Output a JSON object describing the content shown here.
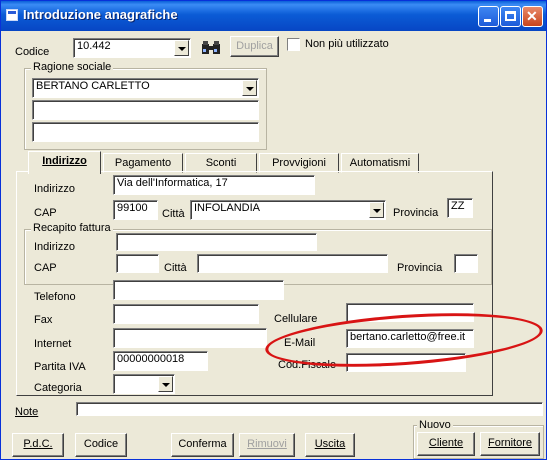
{
  "window": {
    "title": "Introduzione anagrafiche"
  },
  "header": {
    "codice_label": "Codice",
    "codice_value": "10.442",
    "duplica_label": "Duplica",
    "non_utilizzato_label": "Non più utilizzato",
    "non_utilizzato_checked": false
  },
  "ragione_sociale": {
    "title": "Ragione sociale",
    "line1": "BERTANO CARLETTO",
    "line2": "",
    "line3": ""
  },
  "tabs": [
    {
      "label": "Indirizzo",
      "active": true
    },
    {
      "label": "Pagamento",
      "active": false
    },
    {
      "label": "Sconti",
      "active": false
    },
    {
      "label": "Provvigioni",
      "active": false
    },
    {
      "label": "Automatismi",
      "active": false
    }
  ],
  "indirizzo": {
    "indirizzo_label": "Indirizzo",
    "indirizzo_value": "Via dell'Informatica, 17",
    "cap_label": "CAP",
    "cap_value": "99100",
    "citta_label": "Città",
    "citta_value": "INFOLANDIA",
    "provincia_label": "Provincia",
    "provincia_value": "ZZ"
  },
  "recapito": {
    "title": "Recapito fattura",
    "indirizzo_label": "Indirizzo",
    "indirizzo_value": "",
    "cap_label": "CAP",
    "cap_value": "",
    "citta_label": "Città",
    "citta_value": "",
    "provincia_label": "Provincia",
    "provincia_value": ""
  },
  "contatti": {
    "telefono_label": "Telefono",
    "telefono_value": "",
    "fax_label": "Fax",
    "fax_value": "",
    "cellulare_label": "Cellulare",
    "cellulare_value": "",
    "internet_label": "Internet",
    "internet_value": "",
    "email_label": "E-Mail",
    "email_value": "bertano.carletto@free.it",
    "partita_iva_label": "Partita IVA",
    "partita_iva_value": "00000000018",
    "cod_fiscale_label": "Cod.Fiscale",
    "cod_fiscale_value": "",
    "categoria_label": "Categoria",
    "categoria_value": ""
  },
  "note": {
    "label": "Note",
    "value": ""
  },
  "buttons": {
    "pdc": "P.d.C.",
    "codice": "Codice",
    "conferma": "Conferma",
    "rimuovi": "Rimuovi",
    "uscita": "Uscita",
    "nuovo_title": "Nuovo",
    "cliente": "Cliente",
    "fornitore": "Fornitore"
  },
  "colors": {
    "title_bar": "#0b5cd6",
    "highlight_ellipse": "#d81414",
    "dialog_bg": "#ece9d8"
  }
}
